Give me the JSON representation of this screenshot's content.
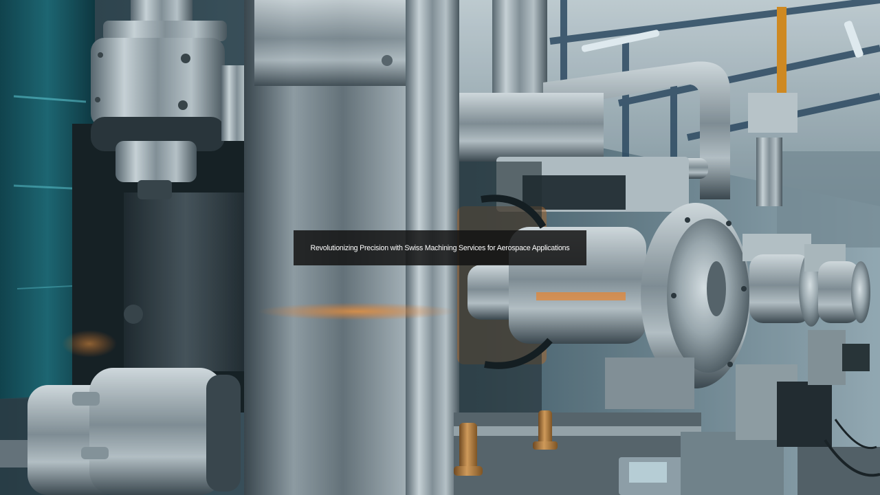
{
  "caption": {
    "text": "Revolutionizing Precision with Swiss Machining Services for Aerospace Applications"
  },
  "photo": {
    "subject": "industrial machining equipment in a factory",
    "colors": {
      "steel": "#b9c2c8",
      "teal": "#14505a",
      "orange_glow": "#e07a22",
      "brass": "#c8823a"
    }
  }
}
